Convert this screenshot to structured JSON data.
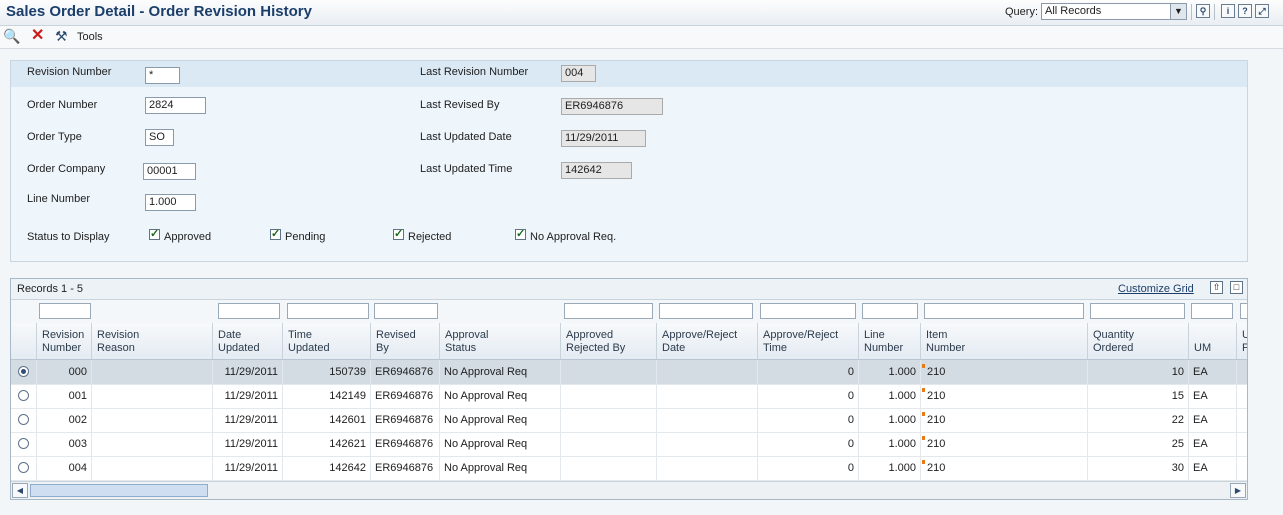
{
  "title": "Sales Order Detail - Order Revision History",
  "query": {
    "label": "Query:",
    "value": "All Records"
  },
  "header_icons": [
    "filter-icon",
    "info-icon",
    "help-icon",
    "expand-icon"
  ],
  "toolbar": {
    "tools_label": "Tools"
  },
  "form": {
    "revision_number": {
      "label": "Revision Number",
      "value": "*"
    },
    "order_number": {
      "label": "Order Number",
      "value": "2824"
    },
    "order_type": {
      "label": "Order Type",
      "value": "SO"
    },
    "order_company": {
      "label": "Order Company",
      "value": "00001"
    },
    "line_number": {
      "label": "Line Number",
      "value": "1.000"
    },
    "last_revision_number": {
      "label": "Last Revision Number",
      "value": "004"
    },
    "last_revised_by": {
      "label": "Last Revised By",
      "value": "ER6946876"
    },
    "last_updated_date": {
      "label": "Last Updated Date",
      "value": "11/29/2011"
    },
    "last_updated_time": {
      "label": "Last Updated Time",
      "value": "142642"
    },
    "status_label": "Status to Display",
    "statuses": [
      {
        "label": "Approved",
        "checked": true
      },
      {
        "label": "Pending",
        "checked": true
      },
      {
        "label": "Rejected",
        "checked": true
      },
      {
        "label": "No Approval Req.",
        "checked": true
      }
    ]
  },
  "grid": {
    "records_label": "Records 1 - 5",
    "customize_label": "Customize Grid",
    "columns": [
      {
        "l1": "Revision",
        "l2": "Number"
      },
      {
        "l1": "Revision",
        "l2": "Reason"
      },
      {
        "l1": "Date",
        "l2": "Updated"
      },
      {
        "l1": "Time",
        "l2": "Updated"
      },
      {
        "l1": "Revised",
        "l2": "By"
      },
      {
        "l1": "Approval",
        "l2": "Status"
      },
      {
        "l1": "Approved",
        "l2": "Rejected By"
      },
      {
        "l1": "Approve/Reject",
        "l2": "Date"
      },
      {
        "l1": "Approve/Reject",
        "l2": "Time"
      },
      {
        "l1": "Line",
        "l2": "Number"
      },
      {
        "l1": "Item",
        "l2": "Number"
      },
      {
        "l1": "Quantity",
        "l2": "Ordered"
      },
      {
        "l1": "",
        "l2": "UM"
      },
      {
        "l1": "U",
        "l2": "P"
      }
    ],
    "rows": [
      [
        "000",
        "",
        "11/29/2011",
        "150739",
        "ER6946876",
        "No Approval Req",
        "",
        "",
        "0",
        "1.000",
        "210",
        "10",
        "EA"
      ],
      [
        "001",
        "",
        "11/29/2011",
        "142149",
        "ER6946876",
        "No Approval Req",
        "",
        "",
        "0",
        "1.000",
        "210",
        "15",
        "EA"
      ],
      [
        "002",
        "",
        "11/29/2011",
        "142601",
        "ER6946876",
        "No Approval Req",
        "",
        "",
        "0",
        "1.000",
        "210",
        "22",
        "EA"
      ],
      [
        "003",
        "",
        "11/29/2011",
        "142621",
        "ER6946876",
        "No Approval Req",
        "",
        "",
        "0",
        "1.000",
        "210",
        "25",
        "EA"
      ],
      [
        "004",
        "",
        "11/29/2011",
        "142642",
        "ER6946876",
        "No Approval Req",
        "",
        "",
        "0",
        "1.000",
        "210",
        "30",
        "EA"
      ]
    ],
    "selected_row": 0
  }
}
